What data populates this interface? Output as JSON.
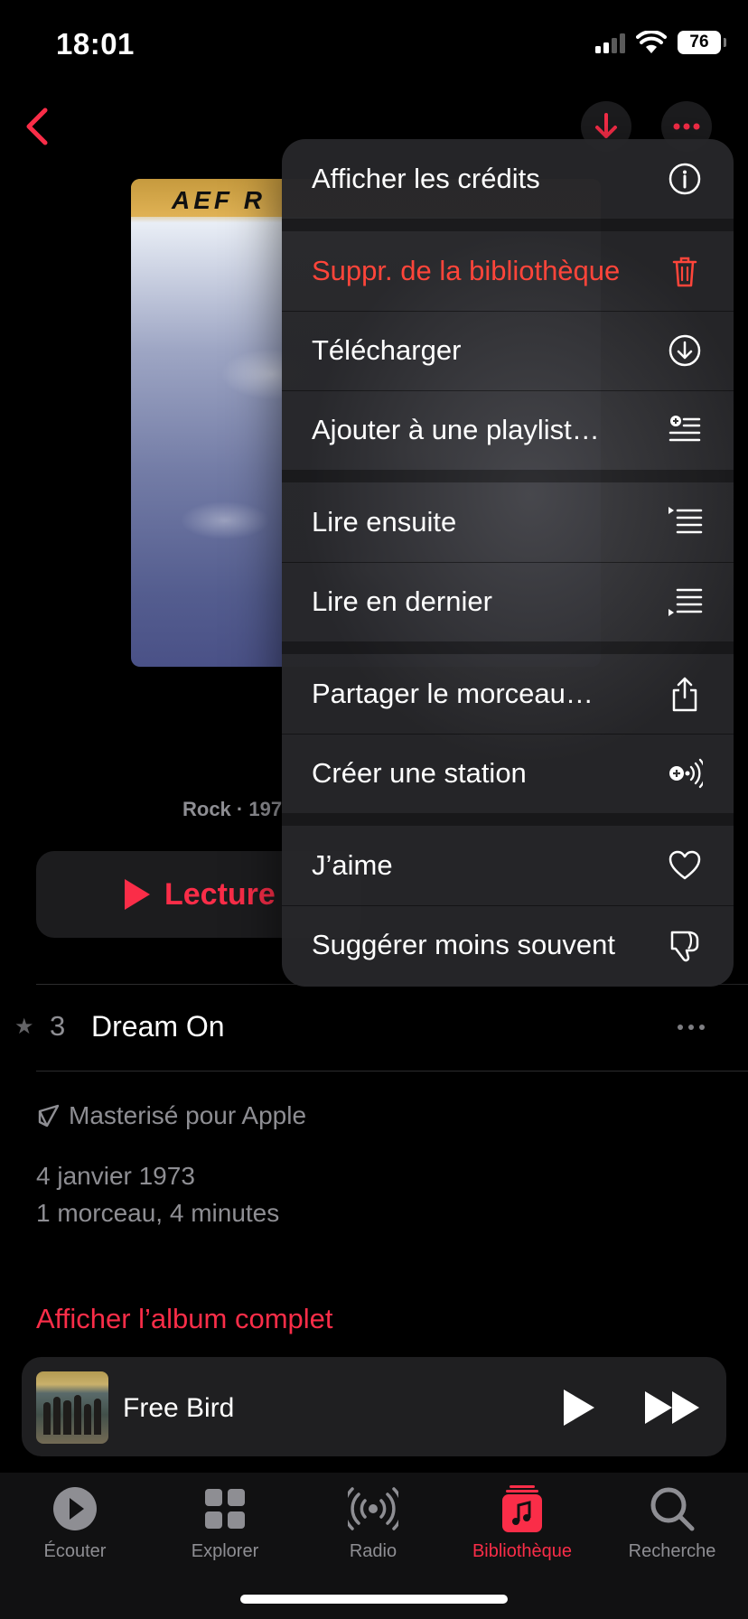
{
  "status_bar": {
    "time": "18:01",
    "battery": "76"
  },
  "album": {
    "art_title": "AEF R",
    "genre_year": "Rock · 197"
  },
  "play_button": {
    "label": "Lecture"
  },
  "track": {
    "number": "3",
    "title": "Dream On"
  },
  "details": {
    "mastered": "Masterisé pour Apple",
    "release_date": "4 janvier 1973",
    "track_count": "1 morceau, 4 minutes"
  },
  "full_album_link": "Afficher l’album complet",
  "mini_player": {
    "title": "Free Bird"
  },
  "tabs": [
    {
      "label": "Écouter",
      "icon": "play-circle-icon"
    },
    {
      "label": "Explorer",
      "icon": "grid-icon"
    },
    {
      "label": "Radio",
      "icon": "radio-waves-icon"
    },
    {
      "label": "Bibliothèque",
      "icon": "music-library-icon",
      "active": true
    },
    {
      "label": "Recherche",
      "icon": "magnifier-icon"
    }
  ],
  "context_menu": {
    "items": [
      {
        "label": "Afficher les crédits",
        "icon": "info-icon"
      },
      {
        "label": "Suppr. de la bibliothèque",
        "icon": "trash-icon",
        "destructive": true
      },
      {
        "label": "Télécharger",
        "icon": "download-circle-icon"
      },
      {
        "label": "Ajouter à une playlist…",
        "icon": "add-to-playlist-icon"
      },
      {
        "label": "Lire ensuite",
        "icon": "play-next-icon"
      },
      {
        "label": "Lire en dernier",
        "icon": "play-last-icon"
      },
      {
        "label": "Partager le morceau…",
        "icon": "share-icon"
      },
      {
        "label": "Créer une station",
        "icon": "create-station-icon"
      },
      {
        "label": "J’aime",
        "icon": "heart-icon"
      },
      {
        "label": "Suggérer moins souvent",
        "icon": "thumbs-down-icon"
      }
    ]
  },
  "colors": {
    "accent": "#fa2d48",
    "destructive": "#ff453a",
    "background": "#000000",
    "secondary_text": "#8e8e93"
  }
}
